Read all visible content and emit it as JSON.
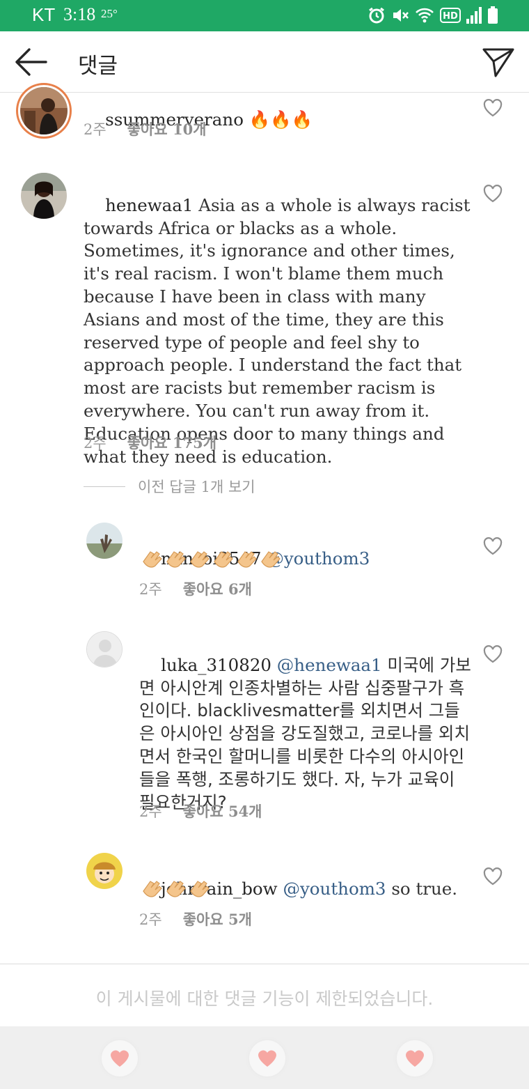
{
  "status_bar": {
    "carrier": "KT",
    "time": "3:18",
    "temperature": "25°",
    "icons": [
      "alarm-icon",
      "mute-icon",
      "wifi-icon",
      "hd-icon",
      "signal-icon",
      "battery-icon"
    ],
    "hd_label": "HD"
  },
  "header": {
    "title": "댓글",
    "back_icon": "arrow-left-icon",
    "share_icon": "paper-plane-icon"
  },
  "comments": [
    {
      "username": "ssummerverano",
      "text": "🔥🔥🔥",
      "time": "2주",
      "likes": "좋아요 10개"
    },
    {
      "username": "henewaa1",
      "text": "Asia as a whole is always racist towards Africa or blacks as a whole. Sometimes, it's ignorance and other times, it's real racism. I won't blame them much because I have been in class with many Asians and most of the time, they are this reserved type of people and feel shy to approach people. I understand the fact that most are racists but remember racism is everywhere. You can't run away from it. Education opens door to many things and what they need is education.",
      "time": "2주",
      "likes": "좋아요 175개",
      "view_previous_replies": "이전 답글 1개 보기",
      "replies": [
        {
          "username": "minsoi3547",
          "mention": "@youthom3",
          "text": "",
          "emoji": "👏👏👏👏👏👏",
          "time": "2주",
          "likes": "좋아요 6개"
        },
        {
          "username": "luka_310820",
          "mention": "@henewaa1",
          "text": "미국에 가보면 아시안계 인종차별하는 사람 십중팔구가 흑인이다. blacklivesmatter를 외치면서 그들은 아시아인 상점을 강도질했고, 코로나를 외치면서 한국인 할머니를 비롯한 다수의 아시아인들을 폭행, 조롱하기도 했다. 자, 누가 교육이 필요한거지?",
          "time": "2주",
          "likes": "좋아요 54개"
        },
        {
          "username": "johnrain_bow",
          "mention": "@youthom3",
          "text": "so true.",
          "emoji": "👏👏👏",
          "time": "2주",
          "likes": "좋아요 5개"
        }
      ]
    }
  ],
  "footer": {
    "notice": "이 게시물에 대한 댓글 기능이 제한되었습니다.",
    "reactions": [
      "heart-emoji",
      "heart-emoji",
      "heart-emoji"
    ]
  },
  "colors": {
    "status_bar": "#1fa865",
    "mention": "#375e86",
    "meta_text": "#9a9a9a"
  }
}
